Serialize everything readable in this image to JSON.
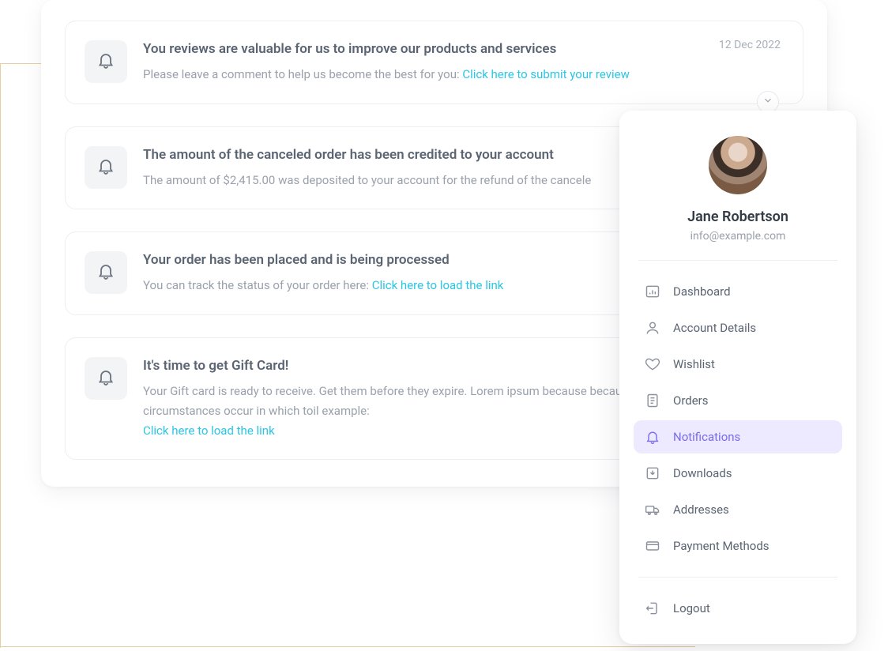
{
  "colors": {
    "link": "#2ac6e5",
    "nav_active_bg": "#edeaff",
    "nav_active_fg": "#7a6cf0"
  },
  "notifications": [
    {
      "date": "12 Dec 2022",
      "title": "You reviews are valuable for us to improve our products and services",
      "body_prefix": "Please leave a comment to help us become the best for you: ",
      "link": "Click here to submit your review",
      "body_suffix": "",
      "has_toggle": true
    },
    {
      "date": "",
      "title": "The amount of the canceled order has been credited to your account",
      "body_prefix": "The amount of $2,415.00  was deposited to your account for the refund of the cancele",
      "link": "",
      "body_suffix": "",
      "has_toggle": false
    },
    {
      "date": "",
      "title": "Your order has been placed and is being processed",
      "body_prefix": "You can track the status of your order here: ",
      "link": "Click here to load the link",
      "body_suffix": "",
      "has_toggle": false
    },
    {
      "date": "",
      "title": "It's time to get Gift Card!",
      "body_prefix": "Your Gift card is ready to receive. Get them before they expire. Lorem ipsum because because occasionally circumstances occur in which toil example: ",
      "link": "Click here to load the link",
      "body_suffix": "",
      "has_toggle": false
    }
  ],
  "sidebar": {
    "user_name": "Jane Robertson",
    "user_email": "info@example.com",
    "items": [
      {
        "icon": "dashboard",
        "label": "Dashboard",
        "active": false
      },
      {
        "icon": "user",
        "label": "Account Details",
        "active": false
      },
      {
        "icon": "heart",
        "label": "Wishlist",
        "active": false
      },
      {
        "icon": "orders",
        "label": "Orders",
        "active": false
      },
      {
        "icon": "bell",
        "label": "Notifications",
        "active": true
      },
      {
        "icon": "download",
        "label": "Downloads",
        "active": false
      },
      {
        "icon": "truck",
        "label": "Addresses",
        "active": false
      },
      {
        "icon": "card",
        "label": "Payment Methods",
        "active": false
      }
    ],
    "logout_label": "Logout"
  }
}
